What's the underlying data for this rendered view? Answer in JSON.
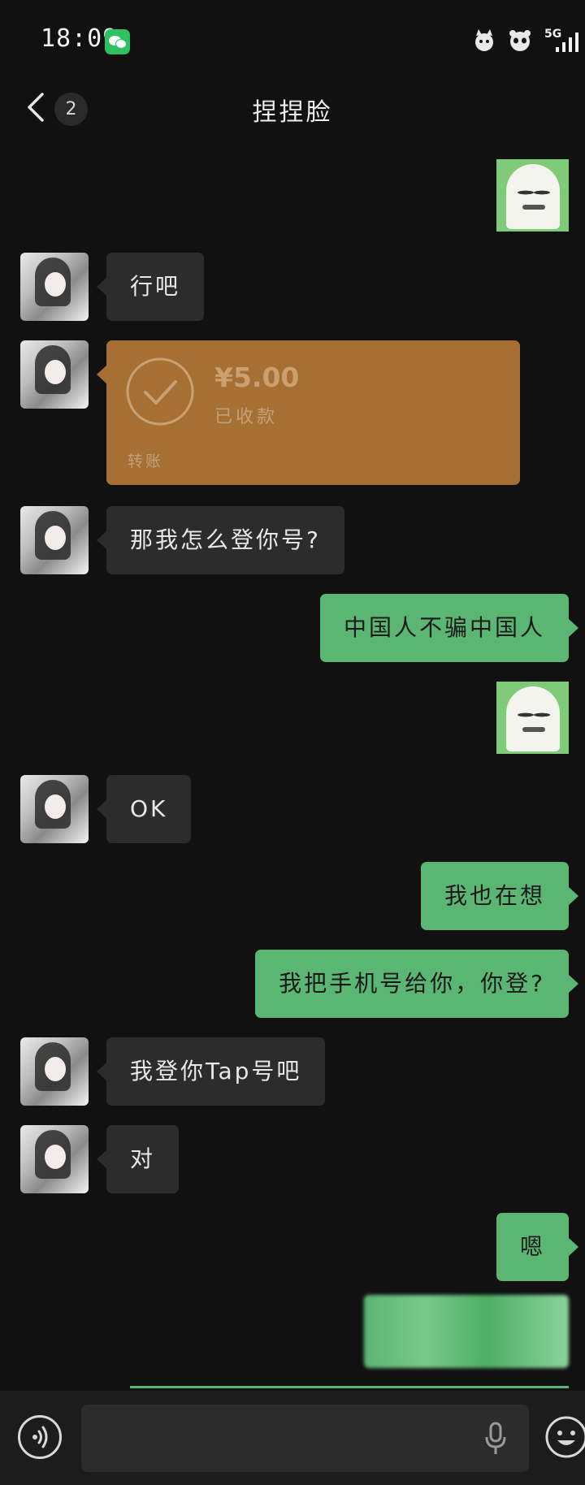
{
  "status_bar": {
    "time": "18:09",
    "network": "5G"
  },
  "header": {
    "unread_count": "2",
    "title": "捏捏脸"
  },
  "messages": [
    {
      "side": "right",
      "type": "sticker"
    },
    {
      "side": "left",
      "type": "text",
      "text": "行吧"
    },
    {
      "side": "left",
      "type": "transfer",
      "amount": "¥5.00",
      "status": "已收款",
      "label": "转账"
    },
    {
      "side": "left",
      "type": "text",
      "text": "那我怎么登你号?"
    },
    {
      "side": "right",
      "type": "text",
      "text": "中国人不骗中国人"
    },
    {
      "side": "right",
      "type": "sticker"
    },
    {
      "side": "left",
      "type": "text",
      "text": "OK"
    },
    {
      "side": "right",
      "type": "text",
      "text": "我也在想"
    },
    {
      "side": "right",
      "type": "text",
      "text": "我把手机号给你，你登?"
    },
    {
      "side": "left",
      "type": "text",
      "text": "我登你Tap号吧"
    },
    {
      "side": "left",
      "type": "text",
      "text": "对"
    },
    {
      "side": "right",
      "type": "text",
      "text": "嗯"
    },
    {
      "side": "right",
      "type": "censored-image"
    }
  ],
  "input_bar": {
    "value": "",
    "icons": [
      "voice-icon",
      "microphone-icon",
      "emoji-icon"
    ]
  },
  "colors": {
    "background": "#111111",
    "incoming_bubble": "#2c2c2c",
    "outgoing_bubble": "#5bb573",
    "transfer_card": "#a66f34",
    "wechat_green": "#2dc160"
  }
}
